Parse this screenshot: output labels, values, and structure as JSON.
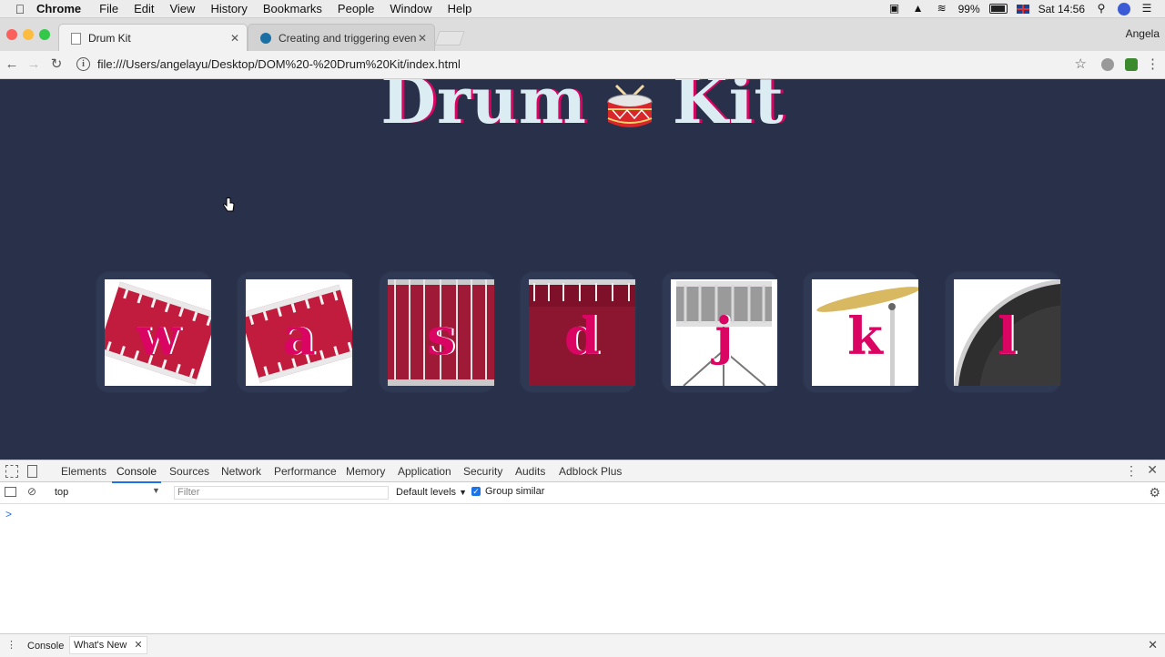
{
  "menubar": {
    "app": "Chrome",
    "items": [
      "File",
      "Edit",
      "View",
      "History",
      "Bookmarks",
      "People",
      "Window",
      "Help"
    ],
    "battery": "99%",
    "clock": "Sat 14:56"
  },
  "tabs": [
    {
      "label": "Drum Kit"
    },
    {
      "label": "Creating and triggering events"
    }
  ],
  "profile": "Angela",
  "address": {
    "url": "file:///Users/angelayu/Desktop/DOM%20-%20Drum%20Kit/index.html"
  },
  "page": {
    "title_left": "Drum",
    "title_right": "Kit",
    "drums": [
      {
        "key": "w",
        "instrument": "tom-1"
      },
      {
        "key": "a",
        "instrument": "tom-2"
      },
      {
        "key": "s",
        "instrument": "tom-3"
      },
      {
        "key": "d",
        "instrument": "tom-4"
      },
      {
        "key": "j",
        "instrument": "snare"
      },
      {
        "key": "k",
        "instrument": "crash"
      },
      {
        "key": "l",
        "instrument": "kick"
      }
    ]
  },
  "devtools": {
    "tabs": [
      "Elements",
      "Console",
      "Sources",
      "Network",
      "Performance",
      "Memory",
      "Application",
      "Security",
      "Audits",
      "Adblock Plus"
    ],
    "active_tab": "Console",
    "context": "top",
    "filter_placeholder": "Filter",
    "levels": "Default levels",
    "group_similar": "Group similar",
    "prompt": ">",
    "drawer_tabs": [
      "Console",
      "What's New"
    ]
  }
}
